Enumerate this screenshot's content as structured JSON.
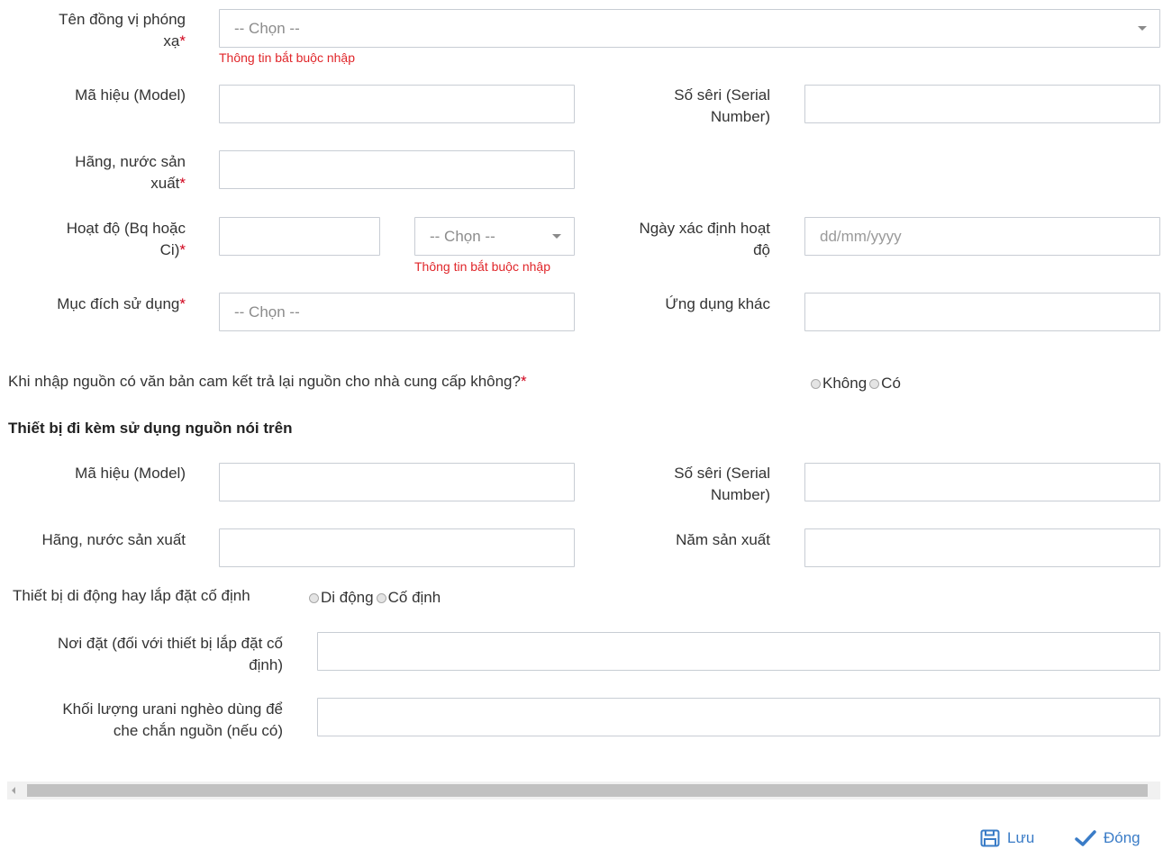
{
  "form": {
    "ten_dong_vi": {
      "label_line1": "Tên đồng vị phóng",
      "label_line2": "xạ",
      "req": "*",
      "select_value": "-- Chọn --",
      "error": "Thông tin bắt buộc nhập"
    },
    "ma_hieu": {
      "label": "Mã hiệu (Model)",
      "value": ""
    },
    "so_seri": {
      "label_line1": "Số sêri (Serial",
      "label_line2": "Number)",
      "value": ""
    },
    "hang_nuoc": {
      "label_line1": "Hãng, nước sản",
      "label_line2": "xuất",
      "req": "*",
      "value": ""
    },
    "hoat_do": {
      "label_line1": "Hoạt độ (Bq hoặc",
      "label_line2": "Ci)",
      "req": "*",
      "value": "",
      "unit_select_value": "-- Chọn --",
      "unit_error": "Thông tin bắt buộc nhập"
    },
    "ngay_xac_dinh": {
      "label_line1": "Ngày xác định hoạt",
      "label_line2": "độ",
      "placeholder": "dd/mm/yyyy"
    },
    "muc_dich": {
      "label": "Mục đích sử dụng",
      "req": "*",
      "select_value": "-- Chọn --"
    },
    "ung_dung_khac": {
      "label": "Ứng dụng khác",
      "value": ""
    },
    "cam_ket": {
      "question": "Khi nhập nguồn có văn bản cam kết trả lại nguồn cho nhà cung cấp không?",
      "req": "*",
      "options": [
        "Không",
        "Có"
      ]
    }
  },
  "equipment": {
    "section_title": "Thiết bị đi kèm sử dụng nguồn nói trên",
    "ma_hieu": {
      "label": "Mã hiệu (Model)",
      "value": ""
    },
    "so_seri": {
      "label_line1": "Số sêri (Serial",
      "label_line2": "Number)",
      "value": ""
    },
    "hang_nuoc": {
      "label": "Hãng, nước sản xuất",
      "value": ""
    },
    "nam_san_xuat": {
      "label": "Năm sản xuất",
      "value": ""
    },
    "loai_thiet_bi": {
      "label": "Thiết bị di động hay lắp đặt cố định",
      "options": [
        "Di động",
        "Cố định"
      ]
    },
    "noi_dat": {
      "label_line1": "Nơi đặt (đối với thiết bị lắp đặt cố",
      "label_line2": "định)",
      "value": ""
    },
    "khoi_luong_urani": {
      "label_line1": "Khối lượng urani nghèo dùng để",
      "label_line2": "che chắn nguồn (nếu có)",
      "value": ""
    }
  },
  "footer": {
    "save_label": "Lưu",
    "close_label": "Đóng"
  },
  "colors": {
    "required": "#d0021b",
    "error": "#e0262a",
    "link": "#3a7cc7",
    "border": "#c8cdd4"
  }
}
